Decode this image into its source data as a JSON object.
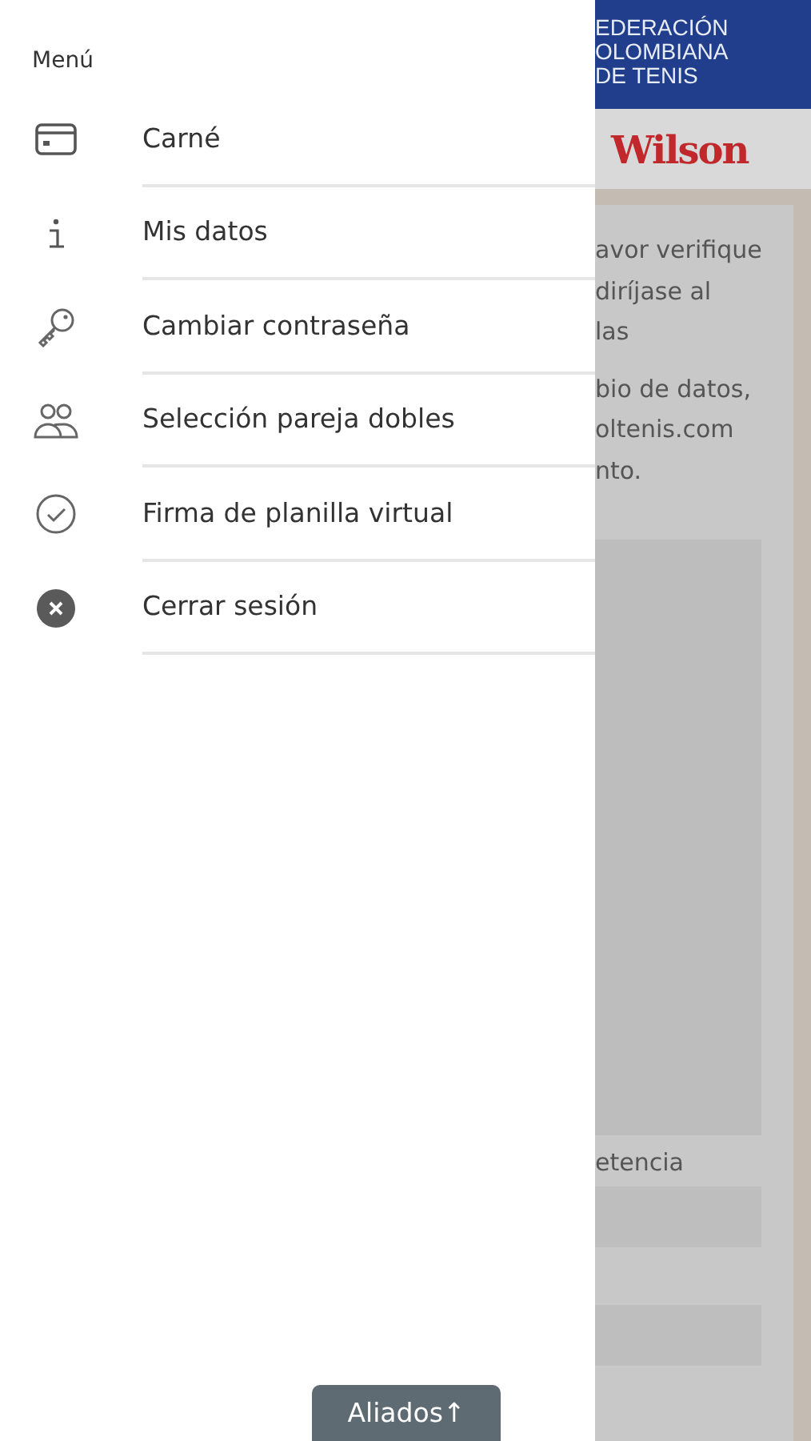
{
  "menu": {
    "title": "Menú",
    "items": [
      {
        "kind": "card",
        "label": "Carné"
      },
      {
        "kind": "info",
        "label": "Mis datos"
      },
      {
        "kind": "key",
        "label": "Cambiar contraseña"
      },
      {
        "kind": "people",
        "label": "Selección pareja dobles"
      },
      {
        "kind": "check",
        "label": "Firma de planilla virtual"
      },
      {
        "kind": "close",
        "label": "Cerrar sesión"
      }
    ]
  },
  "page": {
    "header_lines": [
      "EDERACIÓN",
      "OLOMBIANA",
      "DE TENIS"
    ],
    "sponsor": "Wilson",
    "paragraph_1": [
      "avor verifique",
      "diríjase al",
      "las"
    ],
    "paragraph_2": [
      "bio de datos,",
      "oltenis.com",
      "nto."
    ],
    "field_label": "etencia"
  },
  "footer_button": "Aliados↑"
}
